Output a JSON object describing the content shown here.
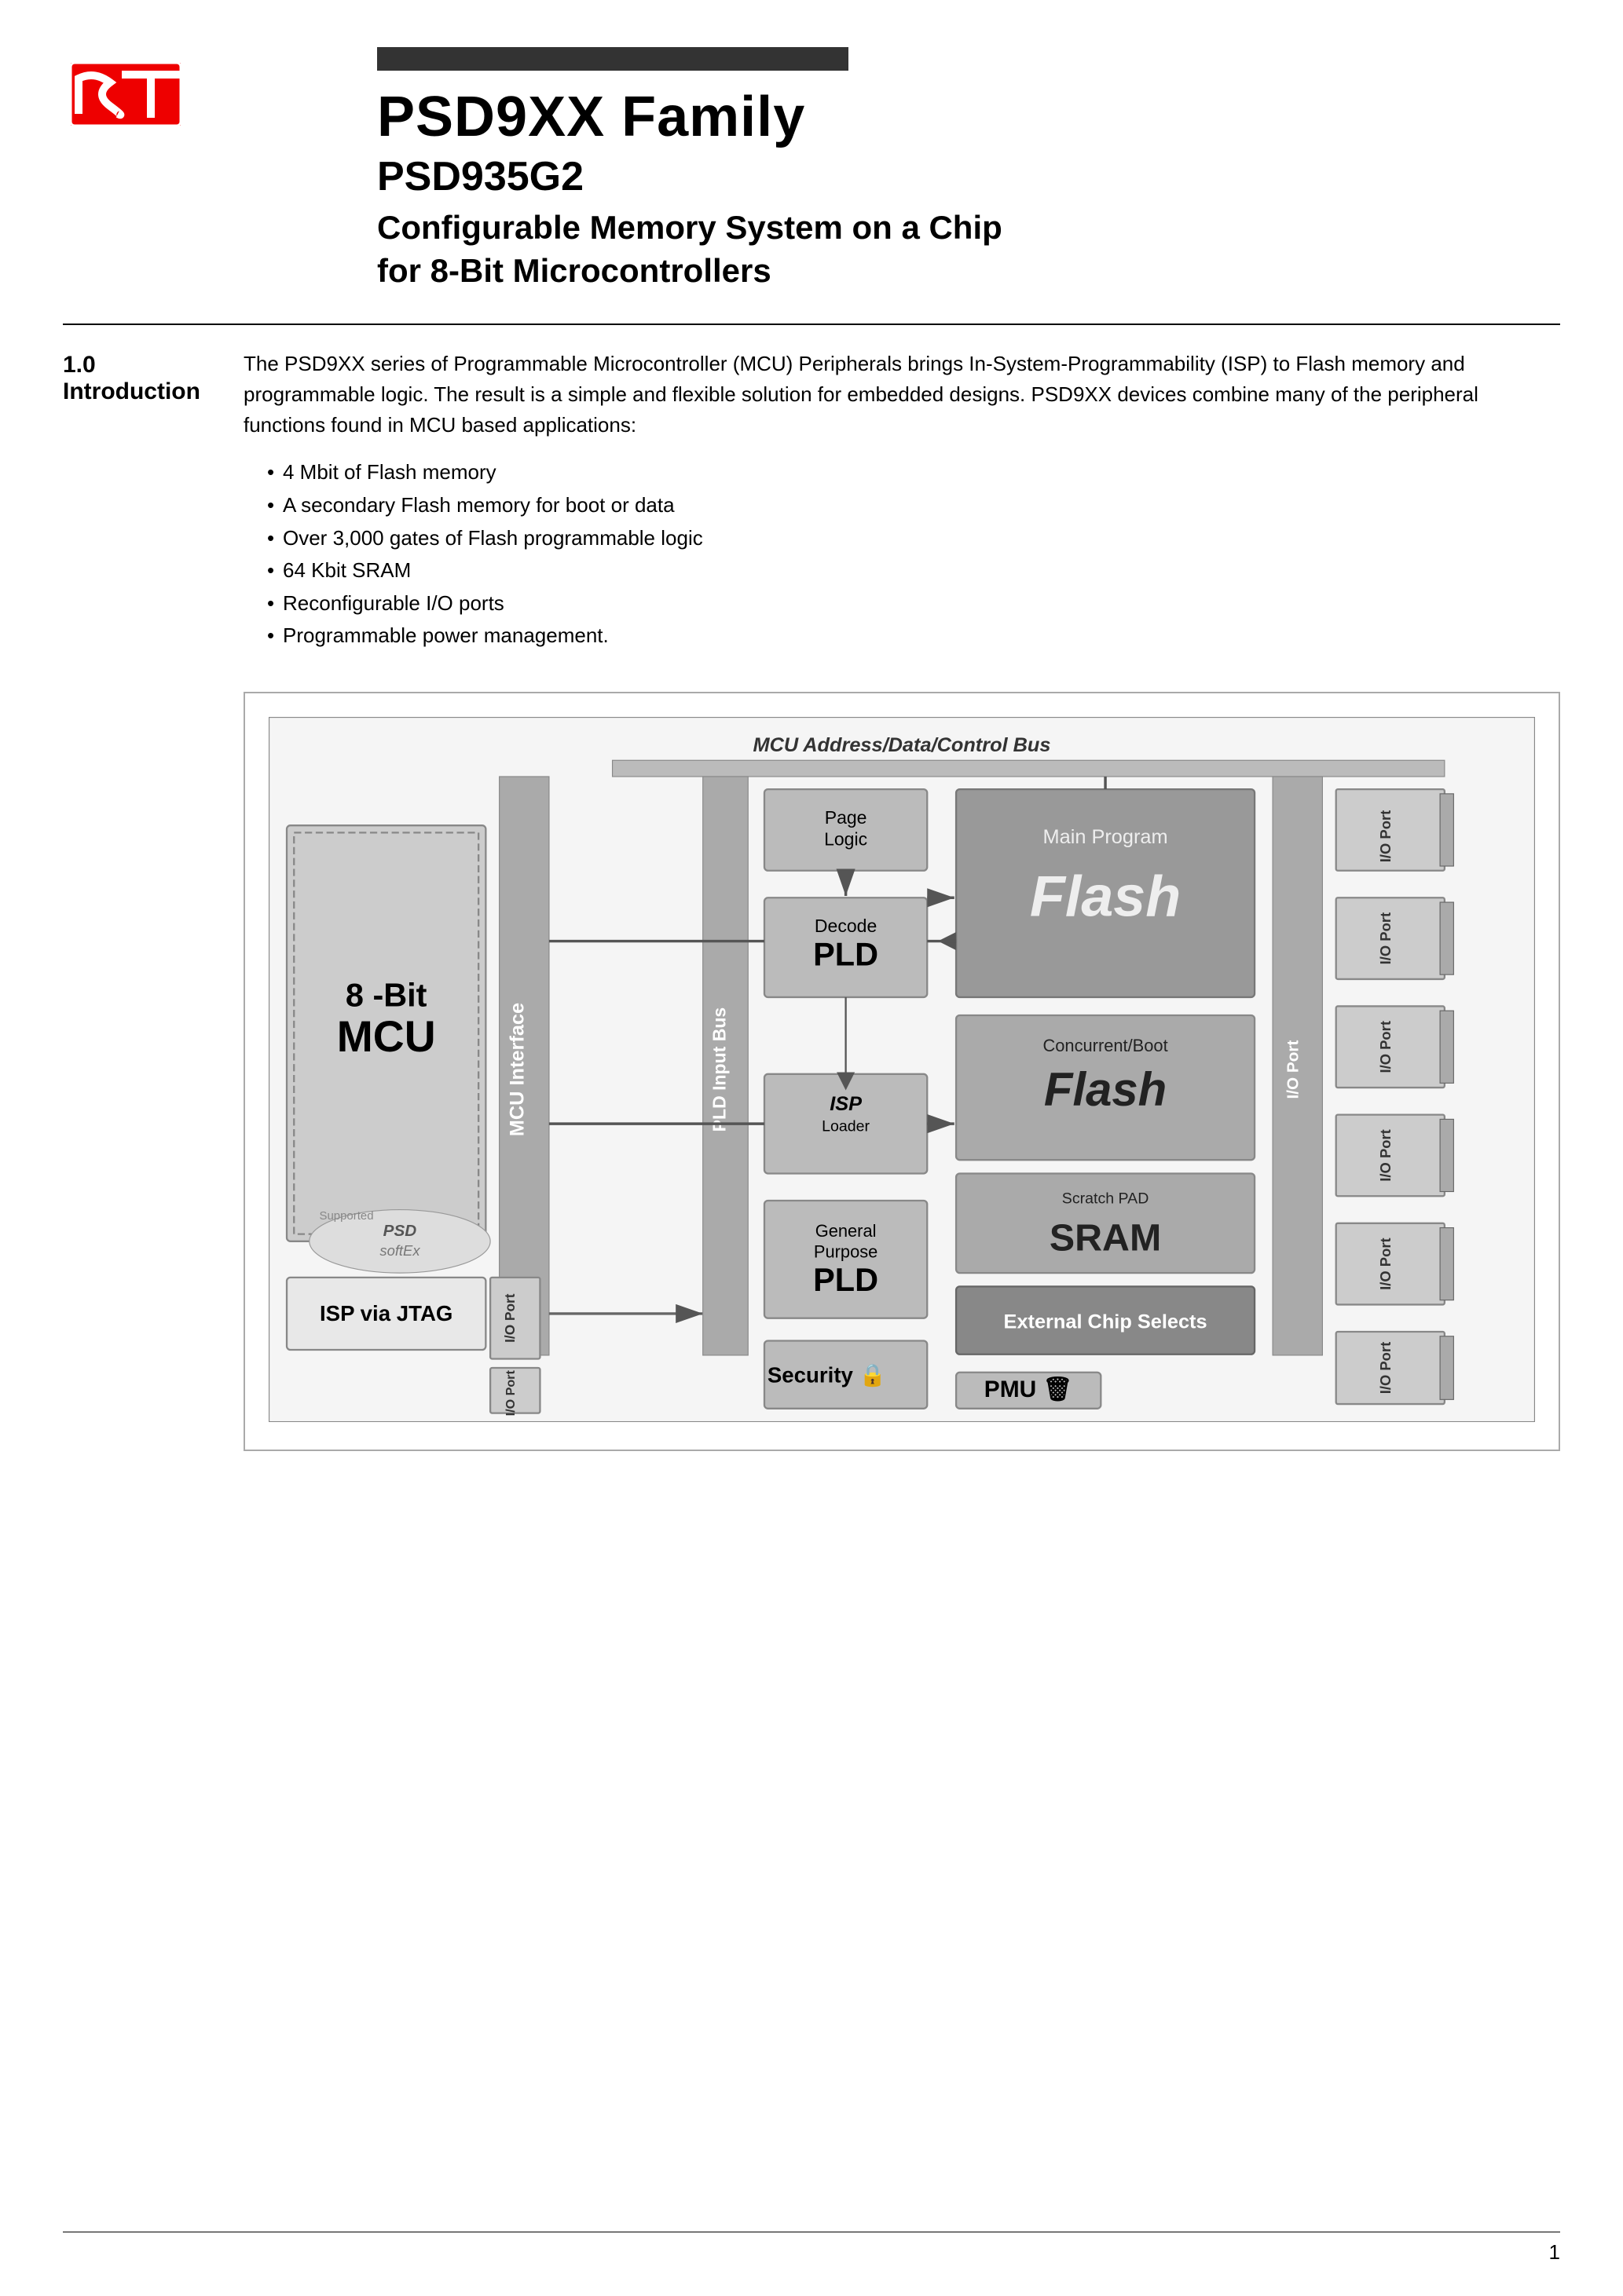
{
  "header": {
    "top_bar_visible": true,
    "main_title": "PSD9XX Family",
    "sub_title": "PSD935G2",
    "description_title": "Configurable Memory System on a Chip\nfor 8-Bit Microcontrollers"
  },
  "section": {
    "number": "1.0",
    "name": "Introduction",
    "intro_paragraph": "The PSD9XX series of Programmable Microcontroller (MCU) Peripherals brings In-System-Programmability (ISP) to Flash memory and programmable logic. The result is a simple and flexible solution for embedded designs. PSD9XX devices combine many of the peripheral functions found in MCU based applications:",
    "bullets": [
      "4 Mbit of Flash memory",
      "A secondary Flash memory for boot or data",
      "Over 3,000 gates of Flash programmable logic",
      "64 Kbit SRAM",
      "Reconfigurable I/O ports",
      "Programmable power management."
    ]
  },
  "diagram": {
    "title": "MCU Address/Data/Control Bus",
    "mcu_label": "8 -Bit\nMCU",
    "mcu_interface_label": "MCU Interface",
    "isp_jtag_label": "ISP via JTAG",
    "isp_loader_label": "ISP\nLoader",
    "page_logic_label": "Page\nLogic",
    "decode_label": "Decode",
    "decode_pld_label": "PLD",
    "main_program_label": "Main Program",
    "main_flash_label": "Flash",
    "concurrent_boot_label": "Concurrent/Boot",
    "concurrent_flash_label": "Flash",
    "scratch_pad_label": "Scratch PAD",
    "sram_label": "SRAM",
    "general_purpose_label": "General\nPurpose",
    "general_pld_label": "PLD",
    "external_chip_selects_label": "External Chip Selects",
    "pld_input_bus_label": "PLD Input Bus",
    "security_label": "Security",
    "pmu_label": "PMU",
    "io_port_labels": [
      "I/O Port",
      "I/O Port",
      "I/O Port",
      "I/O Port",
      "I/O Port",
      "I/O Port",
      "I/O Port",
      "I/O Port"
    ]
  },
  "footer": {
    "page_number": "1"
  }
}
